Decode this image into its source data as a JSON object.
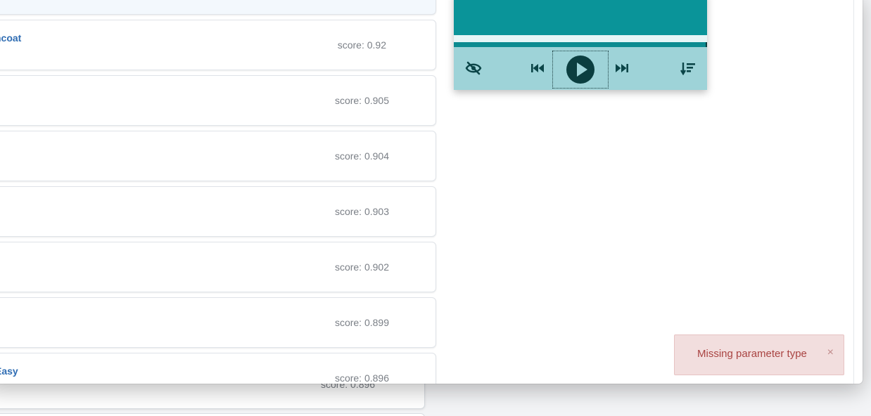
{
  "results": {
    "top_card": {},
    "cards": [
      {
        "title": "ncoat",
        "score": "score: 0.92"
      },
      {
        "title": "",
        "score": "score: 0.905"
      },
      {
        "title": "",
        "score": "score: 0.904"
      },
      {
        "title": "",
        "score": "score: 0.903"
      },
      {
        "title": "",
        "score": "score: 0.902"
      },
      {
        "title": "",
        "score": "score: 0.899"
      },
      {
        "title": "Easy",
        "score": "score: 0.896"
      }
    ],
    "back_card": {
      "score": "score: 0.896"
    }
  },
  "player": {
    "progress": 1.0,
    "colors": {
      "video": "#0a9499",
      "controls": "#9ed3d8",
      "icons": "#0b4548"
    },
    "icons": [
      "eye-off-icon",
      "skip-back-icon",
      "play-icon",
      "skip-forward-icon",
      "sort-icon"
    ]
  },
  "toast": {
    "message": "Missing parameter type",
    "close": "×"
  }
}
